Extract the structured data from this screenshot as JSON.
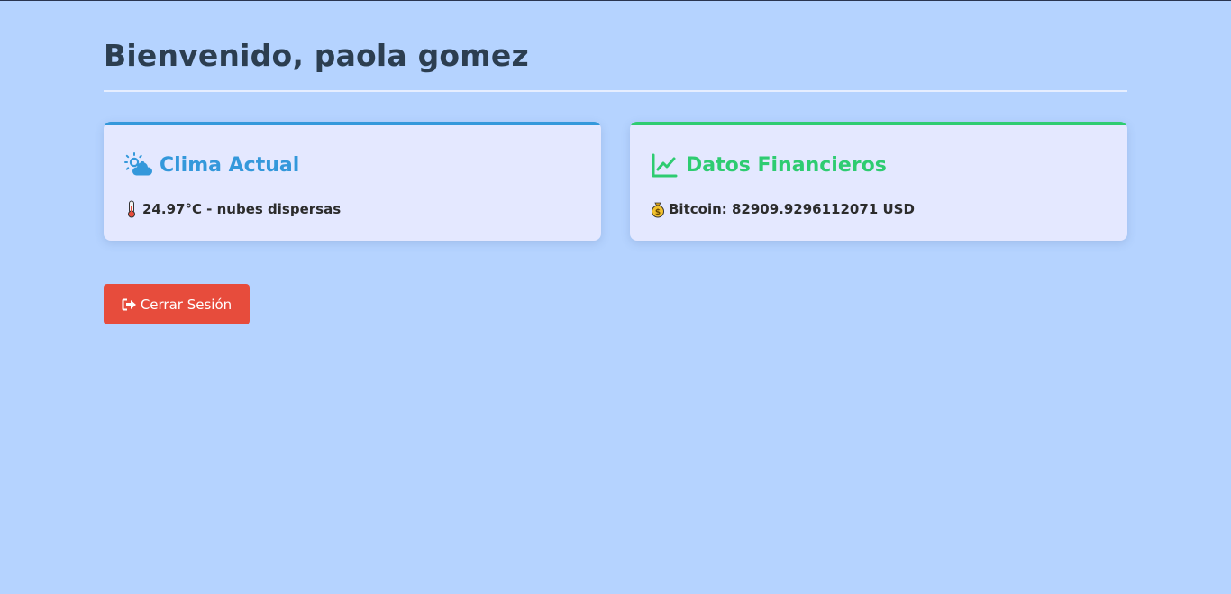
{
  "header": {
    "title": "Bienvenido, paola gomez"
  },
  "weather_card": {
    "icon": "cloud-sun-icon",
    "title": "Clima Actual",
    "line_icon": "thermometer-icon",
    "text": "24.97°C - nubes dispersas",
    "accent": "#3498db"
  },
  "finance_card": {
    "icon": "chart-line-icon",
    "title": "Datos Financieros",
    "line_icon": "money-bag-icon",
    "text": "Bitcoin: 82909.9296112071 USD",
    "accent": "#2ecc71"
  },
  "actions": {
    "logout_label": "Cerrar Sesión",
    "logout_icon": "sign-out-icon",
    "logout_color": "#e74c3c"
  },
  "colors": {
    "background": "#b5d3ff",
    "heading": "#2c3e50",
    "card_background": "#e4e8ff"
  }
}
